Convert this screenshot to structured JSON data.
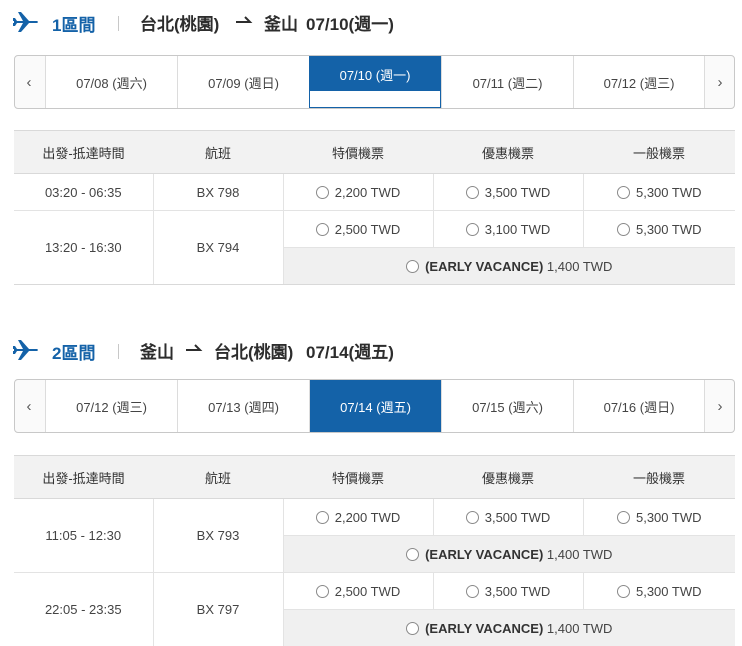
{
  "colors": {
    "accent": "#1462a8",
    "header_bg": "#f2f2f2",
    "early_bg": "#f0f0f0"
  },
  "table_headers": [
    "出發-抵達時間",
    "航班",
    "特價機票",
    "優惠機票",
    "一般機票"
  ],
  "segments": [
    {
      "label": "1區間",
      "origin": "台北(桃園)",
      "destination": "釜山",
      "date": "07/10(週一)",
      "dates": [
        "07/08 (週六)",
        "07/09 (週日)",
        "07/10 (週一)",
        "07/11 (週二)",
        "07/12 (週三)"
      ],
      "active_index": 2,
      "flights": [
        {
          "time": "03:20 - 06:35",
          "flight": "BX 798",
          "fares": [
            "2,200 TWD",
            "3,500 TWD",
            "5,300 TWD"
          ]
        },
        {
          "time": "13:20 - 16:30",
          "flight": "BX 794",
          "fares": [
            "2,500 TWD",
            "3,100 TWD",
            "5,300 TWD"
          ],
          "early": {
            "label": "(EARLY VACANCE)",
            "price": "1,400 TWD"
          }
        }
      ]
    },
    {
      "label": "2區間",
      "origin": "釜山",
      "destination": "台北(桃園)",
      "date": "07/14(週五)",
      "dates": [
        "07/12 (週三)",
        "07/13 (週四)",
        "07/14 (週五)",
        "07/15 (週六)",
        "07/16 (週日)"
      ],
      "active_index": 2,
      "flights": [
        {
          "time": "11:05 - 12:30",
          "flight": "BX 793",
          "fares": [
            "2,200 TWD",
            "3,500 TWD",
            "5,300 TWD"
          ],
          "early": {
            "label": "(EARLY VACANCE)",
            "price": "1,400 TWD"
          }
        },
        {
          "time": "22:05 - 23:35",
          "flight": "BX 797",
          "fares": [
            "2,500 TWD",
            "3,500 TWD",
            "5,300 TWD"
          ],
          "early": {
            "label": "(EARLY VACANCE)",
            "price": "1,400 TWD"
          }
        }
      ]
    }
  ]
}
